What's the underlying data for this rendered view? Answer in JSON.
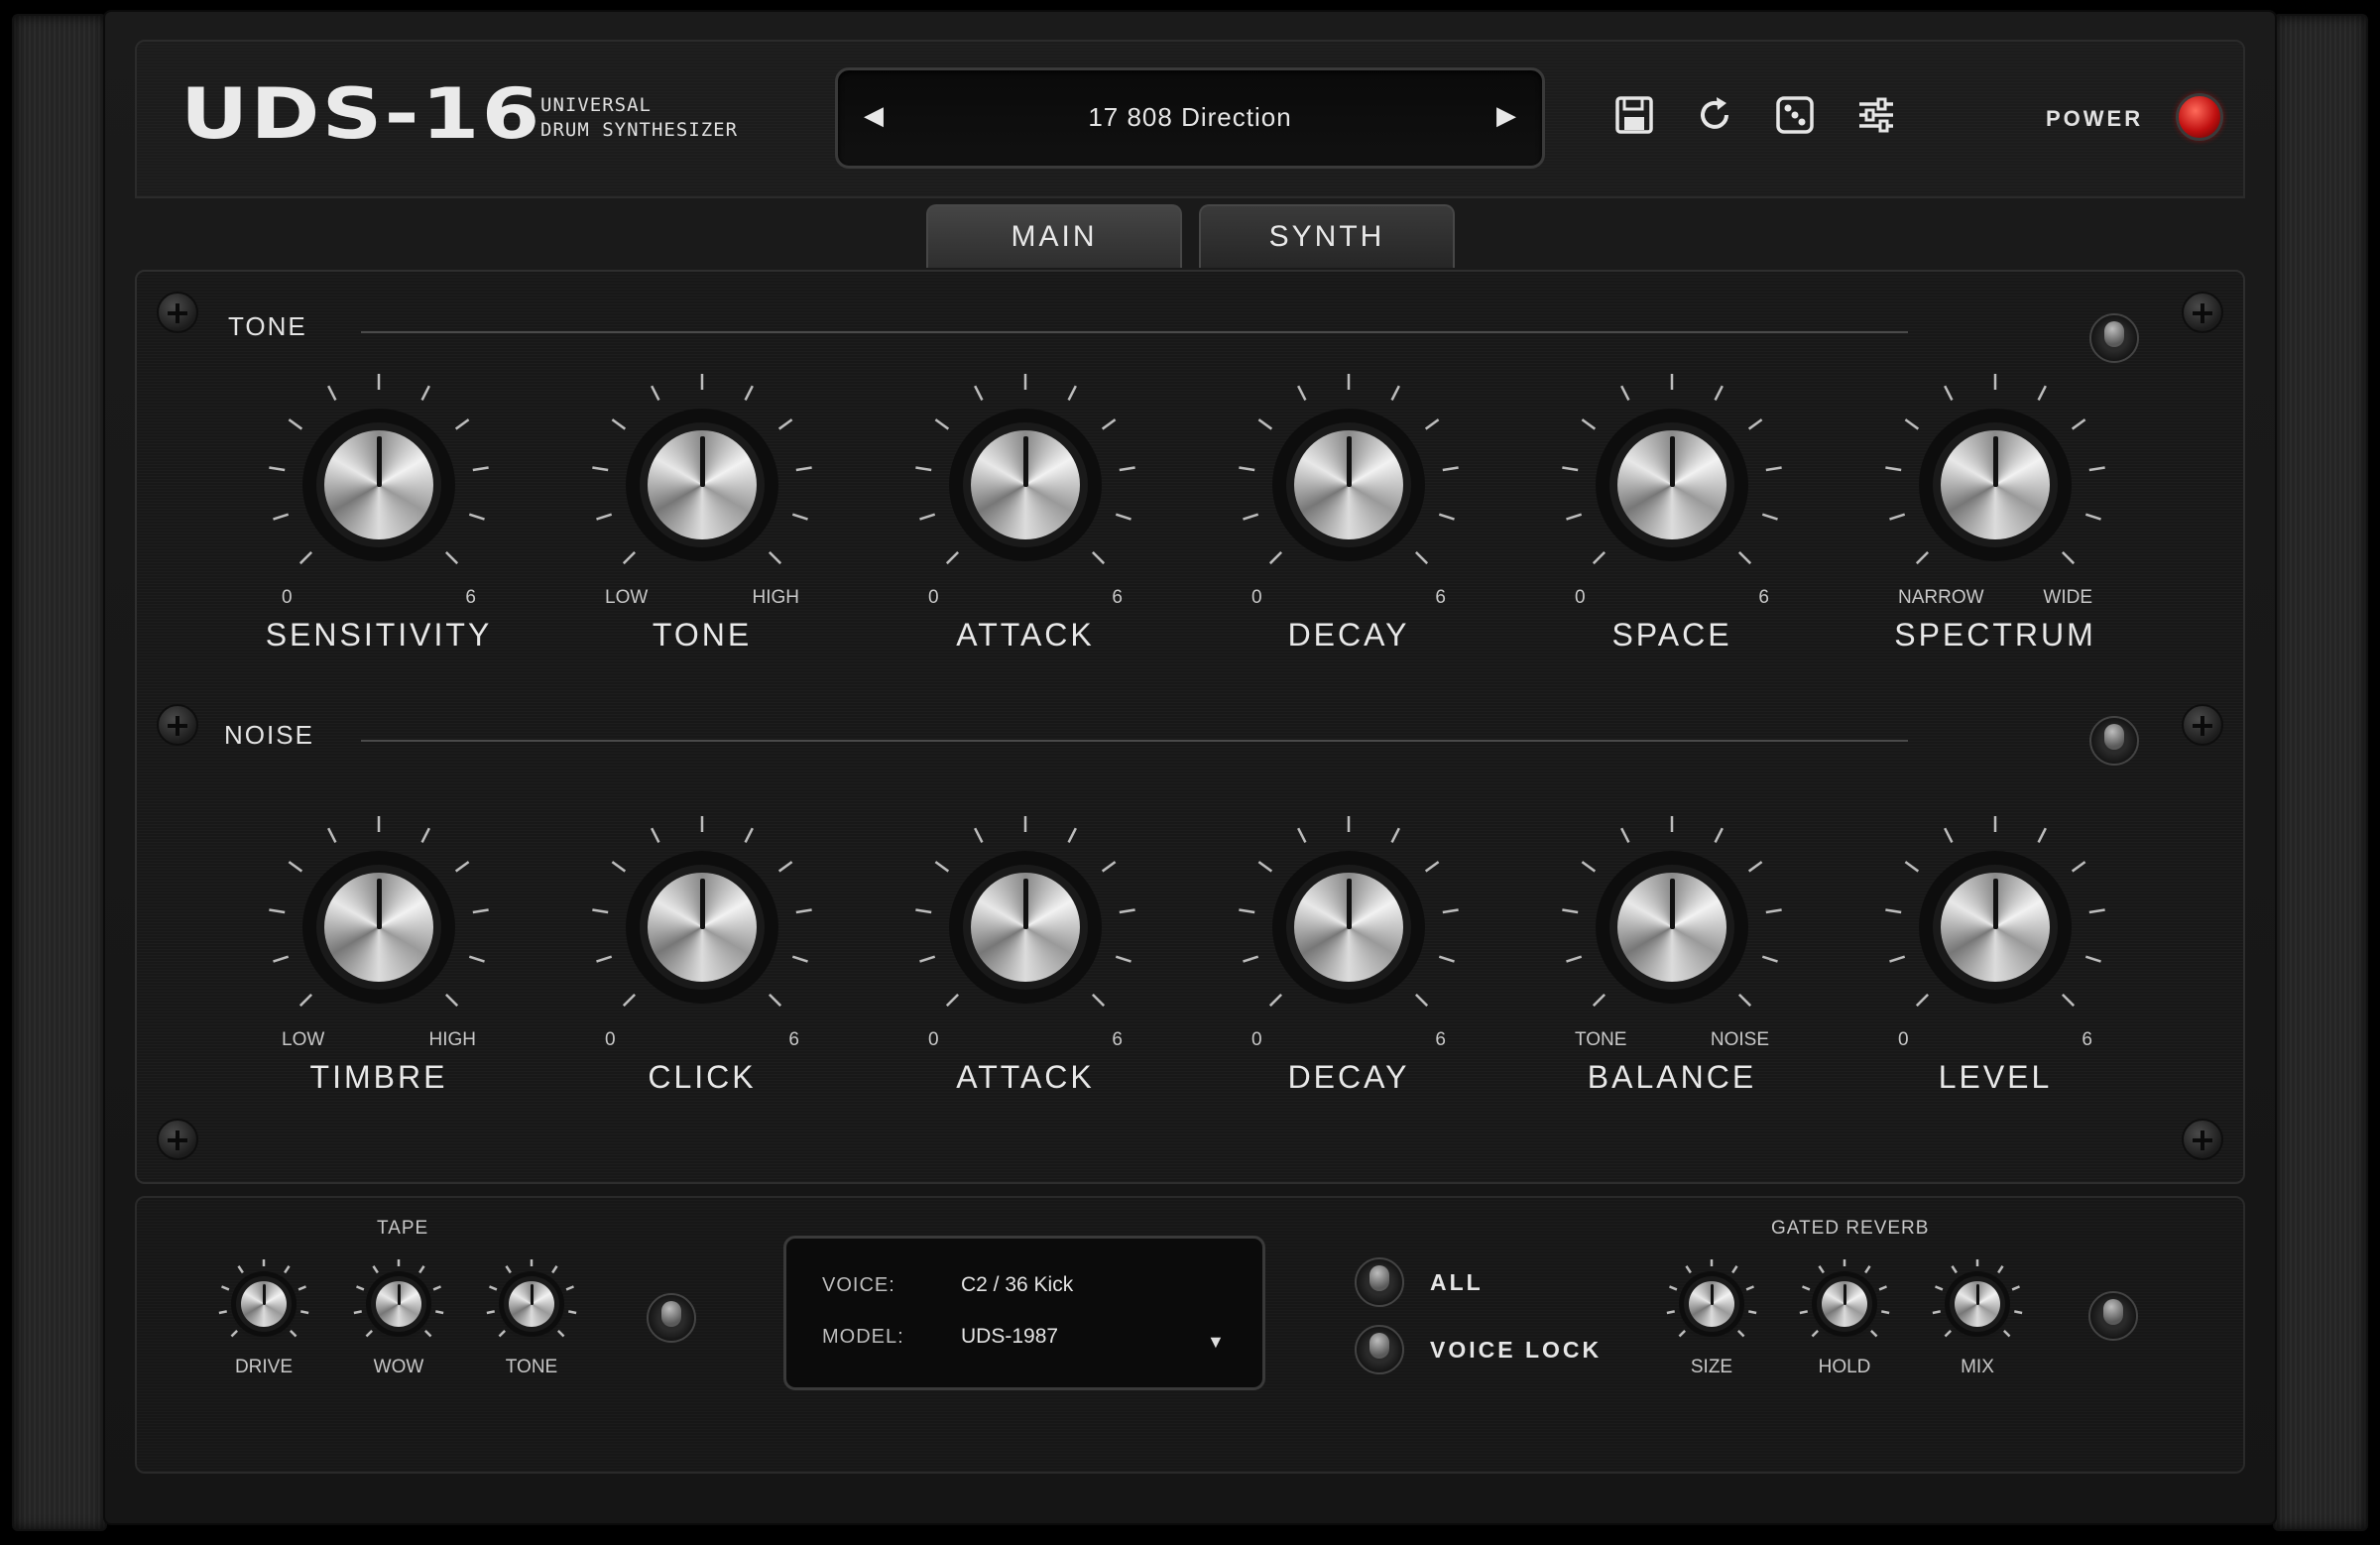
{
  "header": {
    "logo": "UDS-16",
    "subtitle_line1": "UNIVERSAL",
    "subtitle_line2": "DRUM SYNTHESIZER",
    "preset_name": "17  808 Direction",
    "prev_icon": "triangle-left-icon",
    "next_icon": "triangle-right-icon",
    "icons": [
      "save-icon",
      "reload-icon",
      "dice-icon",
      "sliders-icon"
    ],
    "power_label": "POWER",
    "power_color": "#d01515"
  },
  "tabs": [
    {
      "label": "MAIN",
      "active": true
    },
    {
      "label": "SYNTH",
      "active": false
    }
  ],
  "tone": {
    "label": "TONE",
    "knobs": [
      {
        "name": "SENSITIVITY",
        "min": "0",
        "max": "6"
      },
      {
        "name": "TONE",
        "min": "LOW",
        "max": "HIGH"
      },
      {
        "name": "ATTACK",
        "min": "0",
        "max": "6"
      },
      {
        "name": "DECAY",
        "min": "0",
        "max": "6"
      },
      {
        "name": "SPACE",
        "min": "0",
        "max": "6"
      },
      {
        "name": "SPECTRUM",
        "min": "NARROW",
        "max": "WIDE"
      }
    ]
  },
  "noise": {
    "label": "NOISE",
    "knobs": [
      {
        "name": "TIMBRE",
        "min": "LOW",
        "max": "HIGH"
      },
      {
        "name": "CLICK",
        "min": "0",
        "max": "6"
      },
      {
        "name": "ATTACK",
        "min": "0",
        "max": "6"
      },
      {
        "name": "DECAY",
        "min": "0",
        "max": "6"
      },
      {
        "name": "BALANCE",
        "min": "TONE",
        "max": "NOISE"
      },
      {
        "name": "LEVEL",
        "min": "0",
        "max": "6"
      }
    ]
  },
  "tape": {
    "title": "TAPE",
    "knobs": [
      "DRIVE",
      "WOW",
      "TONE"
    ]
  },
  "voice": {
    "voice_label": "VOICE:",
    "voice_value": "C2 / 36  Kick",
    "model_label": "MODEL:",
    "model_value": "UDS-1987",
    "dropdown_glyph": "▼"
  },
  "switches": {
    "all": "ALL",
    "voice_lock": "VOICE LOCK"
  },
  "reverb": {
    "title": "GATED REVERB",
    "knobs": [
      "SIZE",
      "HOLD",
      "MIX"
    ]
  }
}
